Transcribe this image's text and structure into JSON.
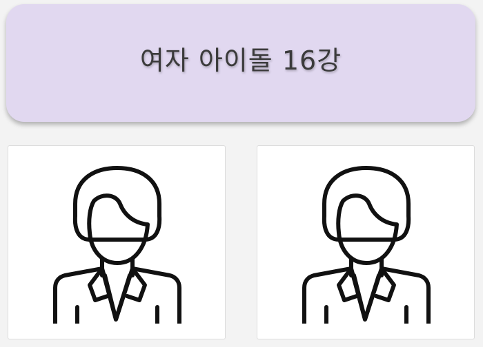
{
  "header": {
    "title": "여자 아이돌 16강"
  },
  "candidates": [
    {
      "icon": "woman-avatar-icon"
    },
    {
      "icon": "woman-avatar-icon"
    }
  ],
  "colors": {
    "banner_background": "#e1d8f0",
    "page_background": "#f3f3f3",
    "card_background": "#ffffff",
    "icon_stroke": "#111111"
  }
}
